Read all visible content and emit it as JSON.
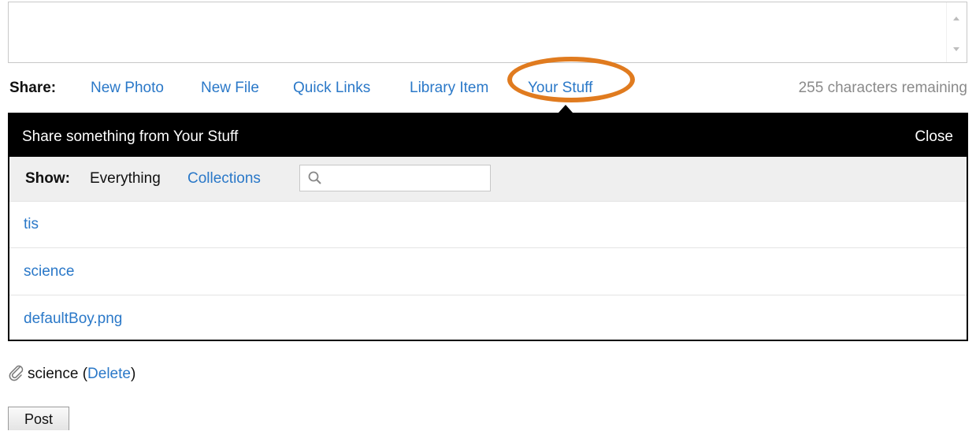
{
  "composer": {
    "placeholder": ""
  },
  "share_bar": {
    "label": "Share:",
    "links": [
      "New Photo",
      "New File",
      "Quick Links",
      "Library Item",
      "Your Stuff"
    ],
    "active": "Your Stuff",
    "remaining": "255 characters remaining"
  },
  "panel": {
    "title": "Share something from Your Stuff",
    "close_label": "Close",
    "show_label": "Show:",
    "filters": [
      "Everything",
      "Collections"
    ],
    "search": {
      "value": "",
      "icon": "search-icon"
    },
    "items": [
      "tis",
      "science",
      "defaultBoy.png"
    ]
  },
  "attachment": {
    "icon": "paperclip-icon",
    "name": "science",
    "open_paren": "(",
    "delete_label": "Delete",
    "close_paren": ")"
  },
  "post_label": "Post",
  "colors": {
    "link": "#2a78c8",
    "highlight": "#e07b1f",
    "header": "#000000"
  }
}
